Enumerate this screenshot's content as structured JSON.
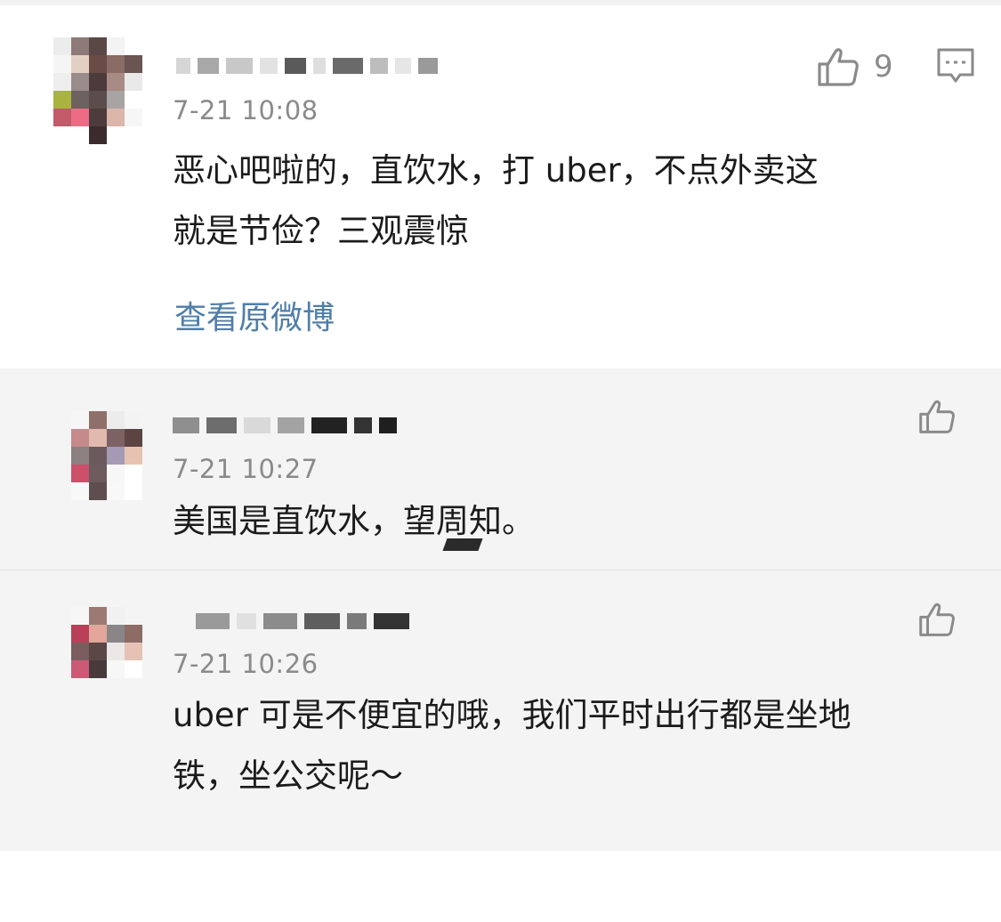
{
  "main_comment": {
    "like_count": "9",
    "time": "7-21 10:08",
    "content": "恶心吧啦的，直饮水，打 uber，不点外卖这\n就是节俭？三观震惊",
    "link": "查看原微博",
    "like_icon": "thumbs-up-icon",
    "comment_icon": "comment-icon"
  },
  "replies": [
    {
      "time": "7-21 10:27",
      "content": "美国是直饮水，望周知。",
      "like_icon": "thumbs-up-icon"
    },
    {
      "time": "7-21 10:26",
      "content": "uber 可是不便宜的哦，我们平时出行都是坐地\n铁，坐公交呢～",
      "like_icon": "thumbs-up-icon"
    }
  ],
  "colors": {
    "link": "#4f7ea8",
    "meta_gray": "#8a8a8a",
    "reply_bg": "#f4f4f4",
    "text": "#1b1b1b"
  }
}
